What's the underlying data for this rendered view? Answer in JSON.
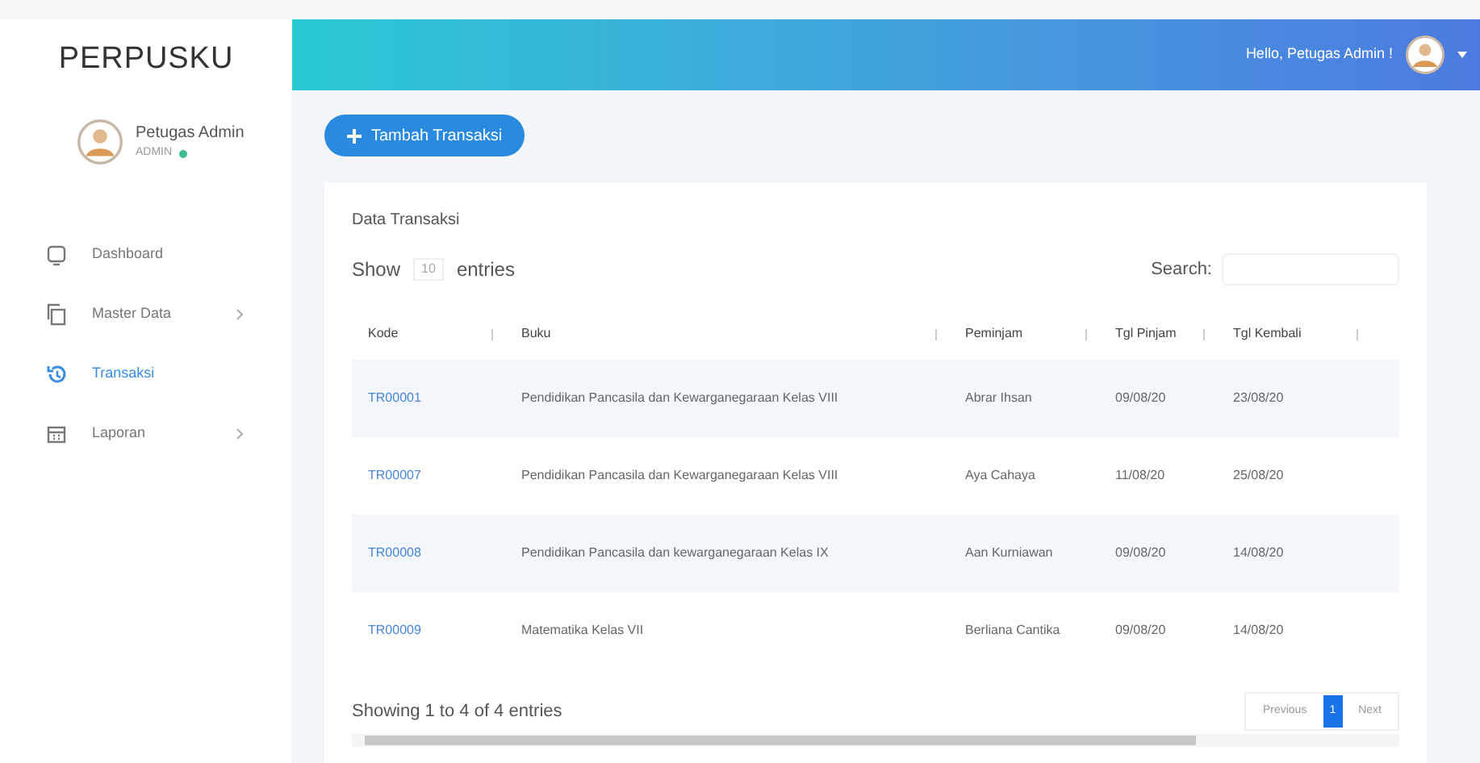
{
  "sidebar": {
    "brand": "PERPUSKU",
    "user": {
      "name": "Petugas Admin",
      "role": "ADMIN",
      "online": true
    },
    "items": [
      {
        "label": "Dashboard",
        "selected": false,
        "submenu": false
      },
      {
        "label": "Master Data",
        "selected": false,
        "submenu": true
      },
      {
        "label": "Transaksi",
        "selected": true,
        "submenu": false
      },
      {
        "label": "Laporan",
        "selected": false,
        "submenu": true
      }
    ]
  },
  "header": {
    "greeting": "Hello, Petugas Admin !"
  },
  "add_button": "Tambah Transaksi",
  "card": {
    "title": "Data Transaksi",
    "show_label": "Show",
    "page_size": "10",
    "entries_label": "entries",
    "search_label": "Search:",
    "table": {
      "columns": [
        "Kode",
        "Buku",
        "Peminjam",
        "Tgl Pinjam",
        "Tgl Kembali"
      ],
      "rows": [
        [
          "TR00001",
          "Pendidikan Pancasila dan Kewarganegaraan Kelas VIII",
          "Abrar Ihsan",
          "09/08/20",
          "23/08/20"
        ],
        [
          "TR00007",
          "Pendidikan Pancasila dan Kewarganegaraan Kelas VIII",
          "Aya Cahaya",
          "11/08/20",
          "25/08/20"
        ],
        [
          "TR00008",
          "Pendidikan Pancasila dan kewarganegaraan Kelas IX",
          "Aan Kurniawan",
          "09/08/20",
          "14/08/20"
        ],
        [
          "TR00009",
          "Matematika Kelas VII",
          "Berliana Cantika",
          "09/08/20",
          "14/08/20"
        ]
      ]
    },
    "info": "Showing 1 to 4 of 4 entries",
    "pagination": [
      {
        "label": "Previous",
        "selected": false
      },
      {
        "label": "1",
        "selected": true
      },
      {
        "label": "Next",
        "selected": false
      }
    ]
  }
}
